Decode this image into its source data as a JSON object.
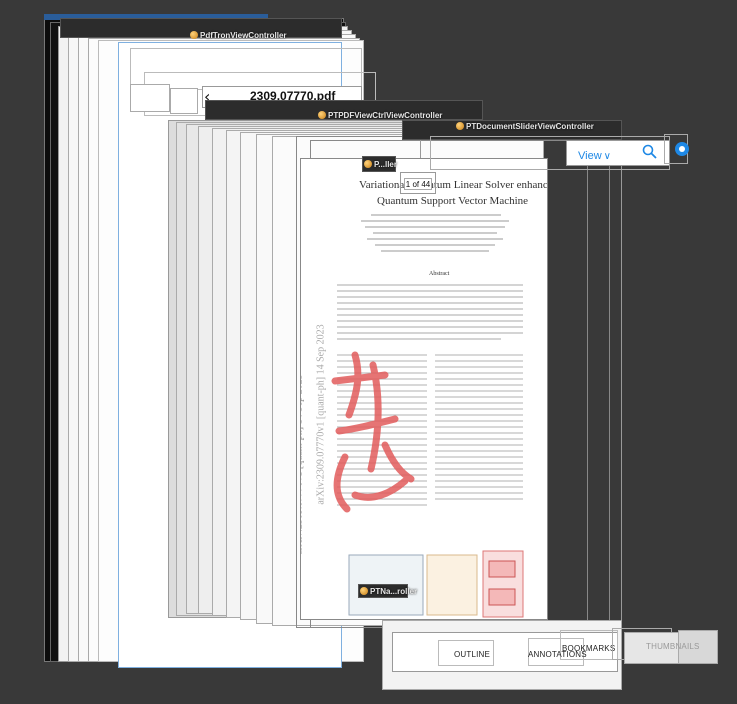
{
  "controllers": {
    "pdf_tron": "PdfTronViewController",
    "pdf_view_ctrl": "PTPDFViewCtrlViewController",
    "document_slider": "PTDocumentSliderViewController",
    "page_indicator": "P...ller",
    "navigation": "PTNa...roller"
  },
  "toolbar": {
    "document_title": "2309.07770.pdf",
    "back_glyph": "‹",
    "view_button": "View",
    "view_chevron": "∨"
  },
  "page_indicator": {
    "text": "1 of 44"
  },
  "paper": {
    "title_line1": "Variational Quantum Linear Solver enhanced",
    "title_line2": "Quantum Support Vector Machine",
    "arxiv_stamp": "arXiv:2309.07770v1 [quant-ph] 14 Sep 2023",
    "abstract_heading": "Abstract"
  },
  "tabs": {
    "outline": "OUTLINE",
    "annotations": "ANNOTATIONS",
    "bookmarks": "BOOKMARKS",
    "thumbnails": "THUMBNAILS"
  },
  "colors": {
    "background": "#393939",
    "layer_edge": "#8a8a8a",
    "accent_blue": "#1e88e5",
    "controller_bar": "#2c2c2c",
    "red_seal": "#e25c5c"
  }
}
